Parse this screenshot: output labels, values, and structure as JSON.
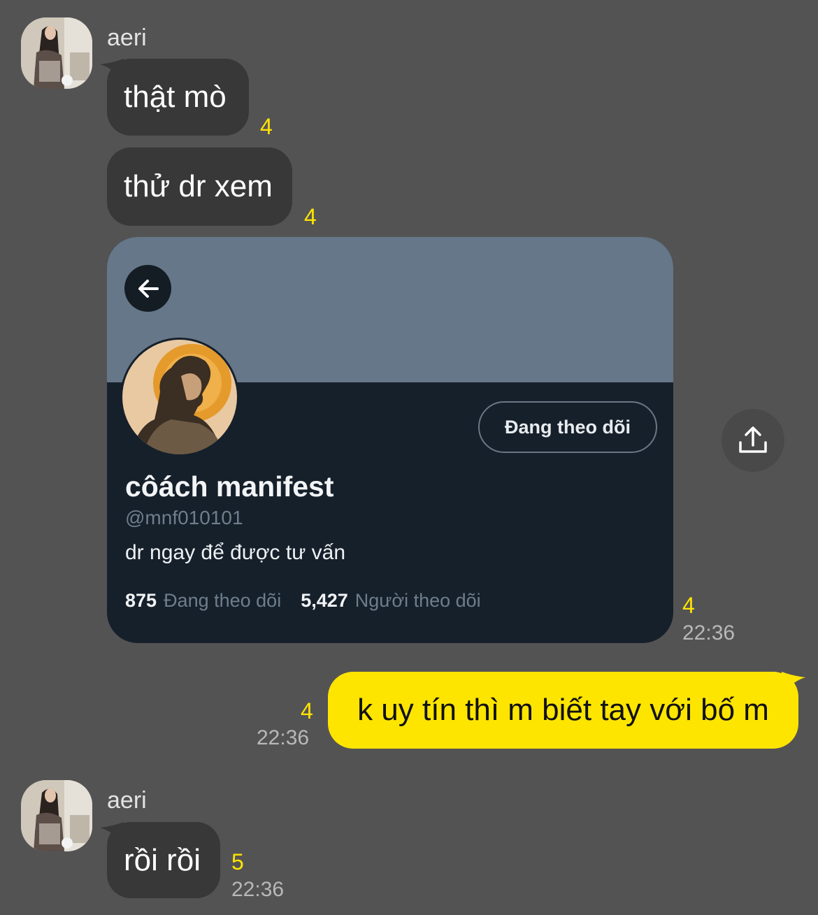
{
  "messages": {
    "group1": {
      "sender": "aeri",
      "bubble1": {
        "text": "thật mò",
        "unread": "4"
      },
      "bubble2": {
        "text": "thử dr xem",
        "unread": "4"
      },
      "card_unread": "4",
      "card_time": "22:36"
    },
    "profile_card": {
      "follow_button": "Đang theo dõi",
      "name": "côách manifest",
      "handle": "@mnf010101",
      "bio": "dr ngay để được tư vấn",
      "following_count": "875",
      "following_label": "Đang theo dõi",
      "followers_count": "5,427",
      "followers_label": "Người theo dõi"
    },
    "outgoing": {
      "text": "k uy tín thì m biết tay với bố m",
      "unread": "4",
      "time": "22:36"
    },
    "group2": {
      "sender": "aeri",
      "bubble1": {
        "text": "rồi rồi",
        "unread": "5",
        "time": "22:36"
      }
    }
  },
  "icons": {
    "back": "arrow-left-icon",
    "share": "share-upload-icon"
  },
  "colors": {
    "background": "#545354",
    "incoming_bubble": "#393839",
    "outgoing_bubble": "#fee500",
    "unread": "#ffe400",
    "card_bg": "#16202b",
    "card_banner": "#657788"
  }
}
